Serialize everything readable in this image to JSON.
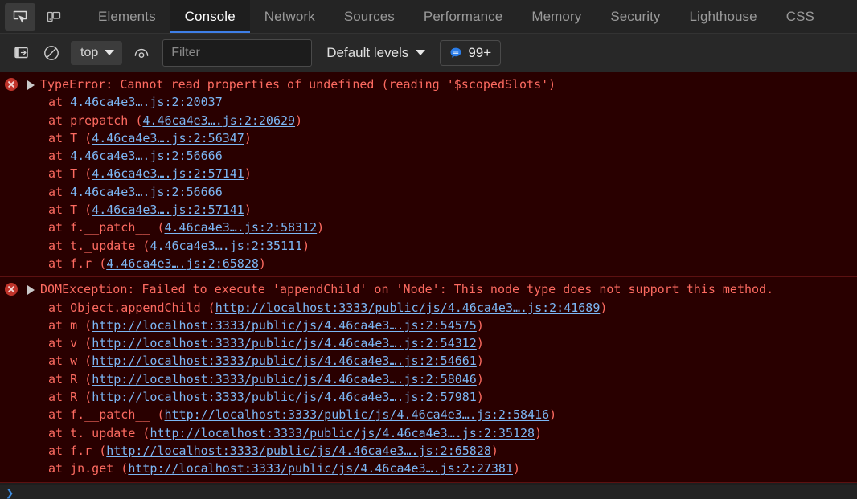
{
  "tabstrip": {
    "inspect_icon": "inspect-element-icon",
    "device_icon": "device-toolbar-icon",
    "tabs": [
      {
        "label": "Elements",
        "selected": false
      },
      {
        "label": "Console",
        "selected": true
      },
      {
        "label": "Network",
        "selected": false
      },
      {
        "label": "Sources",
        "selected": false
      },
      {
        "label": "Performance",
        "selected": false
      },
      {
        "label": "Memory",
        "selected": false
      },
      {
        "label": "Security",
        "selected": false
      },
      {
        "label": "Lighthouse",
        "selected": false
      },
      {
        "label": "CSS",
        "selected": false
      }
    ]
  },
  "toolbar": {
    "sidebar_toggle_icon": "show-console-sidebar-icon",
    "clear_console_icon": "clear-console-icon",
    "context_value": "top",
    "eye_icon": "live-expression-icon",
    "filter_placeholder": "Filter",
    "filter_value": "",
    "levels_label": "Default levels",
    "message_count": "99+",
    "accent_color": "#3e7fe8",
    "error_text_color": "#fc6a60",
    "link_color": "#7cb7f5",
    "error_bg_color": "#290000"
  },
  "console": {
    "errors": [
      {
        "title": "TypeError: Cannot read properties of undefined (reading '$scopedSlots')",
        "frames": [
          {
            "pre": "at ",
            "fn": "",
            "open": "",
            "link": "4.46ca4e3….js:2:20037",
            "close": ""
          },
          {
            "pre": "at ",
            "fn": "prepatch",
            "open": " (",
            "link": "4.46ca4e3….js:2:20629",
            "close": ")"
          },
          {
            "pre": "at ",
            "fn": "T",
            "open": " (",
            "link": "4.46ca4e3….js:2:56347",
            "close": ")"
          },
          {
            "pre": "at ",
            "fn": "",
            "open": "",
            "link": "4.46ca4e3….js:2:56666",
            "close": ""
          },
          {
            "pre": "at ",
            "fn": "T",
            "open": " (",
            "link": "4.46ca4e3….js:2:57141",
            "close": ")"
          },
          {
            "pre": "at ",
            "fn": "",
            "open": "",
            "link": "4.46ca4e3….js:2:56666",
            "close": ""
          },
          {
            "pre": "at ",
            "fn": "T",
            "open": " (",
            "link": "4.46ca4e3….js:2:57141",
            "close": ")"
          },
          {
            "pre": "at ",
            "fn": "f.__patch__",
            "open": " (",
            "link": "4.46ca4e3….js:2:58312",
            "close": ")"
          },
          {
            "pre": "at ",
            "fn": "t._update",
            "open": " (",
            "link": "4.46ca4e3….js:2:35111",
            "close": ")"
          },
          {
            "pre": "at ",
            "fn": "f.r",
            "open": " (",
            "link": "4.46ca4e3….js:2:65828",
            "close": ")"
          }
        ]
      },
      {
        "title": "DOMException: Failed to execute 'appendChild' on 'Node': This node type does not support this method.",
        "frames": [
          {
            "pre": "at ",
            "fn": "Object.appendChild",
            "open": " (",
            "link": "http://localhost:3333/public/js/4.46ca4e3….js:2:41689",
            "close": ")"
          },
          {
            "pre": "at ",
            "fn": "m",
            "open": " (",
            "link": "http://localhost:3333/public/js/4.46ca4e3….js:2:54575",
            "close": ")"
          },
          {
            "pre": "at ",
            "fn": "v",
            "open": " (",
            "link": "http://localhost:3333/public/js/4.46ca4e3….js:2:54312",
            "close": ")"
          },
          {
            "pre": "at ",
            "fn": "w",
            "open": " (",
            "link": "http://localhost:3333/public/js/4.46ca4e3….js:2:54661",
            "close": ")"
          },
          {
            "pre": "at ",
            "fn": "R",
            "open": " (",
            "link": "http://localhost:3333/public/js/4.46ca4e3….js:2:58046",
            "close": ")"
          },
          {
            "pre": "at ",
            "fn": "R",
            "open": " (",
            "link": "http://localhost:3333/public/js/4.46ca4e3….js:2:57981",
            "close": ")"
          },
          {
            "pre": "at ",
            "fn": "f.__patch__",
            "open": " (",
            "link": "http://localhost:3333/public/js/4.46ca4e3….js:2:58416",
            "close": ")"
          },
          {
            "pre": "at ",
            "fn": "t._update",
            "open": " (",
            "link": "http://localhost:3333/public/js/4.46ca4e3….js:2:35128",
            "close": ")"
          },
          {
            "pre": "at ",
            "fn": "f.r",
            "open": " (",
            "link": "http://localhost:3333/public/js/4.46ca4e3….js:2:65828",
            "close": ")"
          },
          {
            "pre": "at ",
            "fn": "jn.get",
            "open": " (",
            "link": "http://localhost:3333/public/js/4.46ca4e3….js:2:27381",
            "close": ")"
          }
        ]
      }
    ],
    "prompt_symbol": "❯"
  }
}
